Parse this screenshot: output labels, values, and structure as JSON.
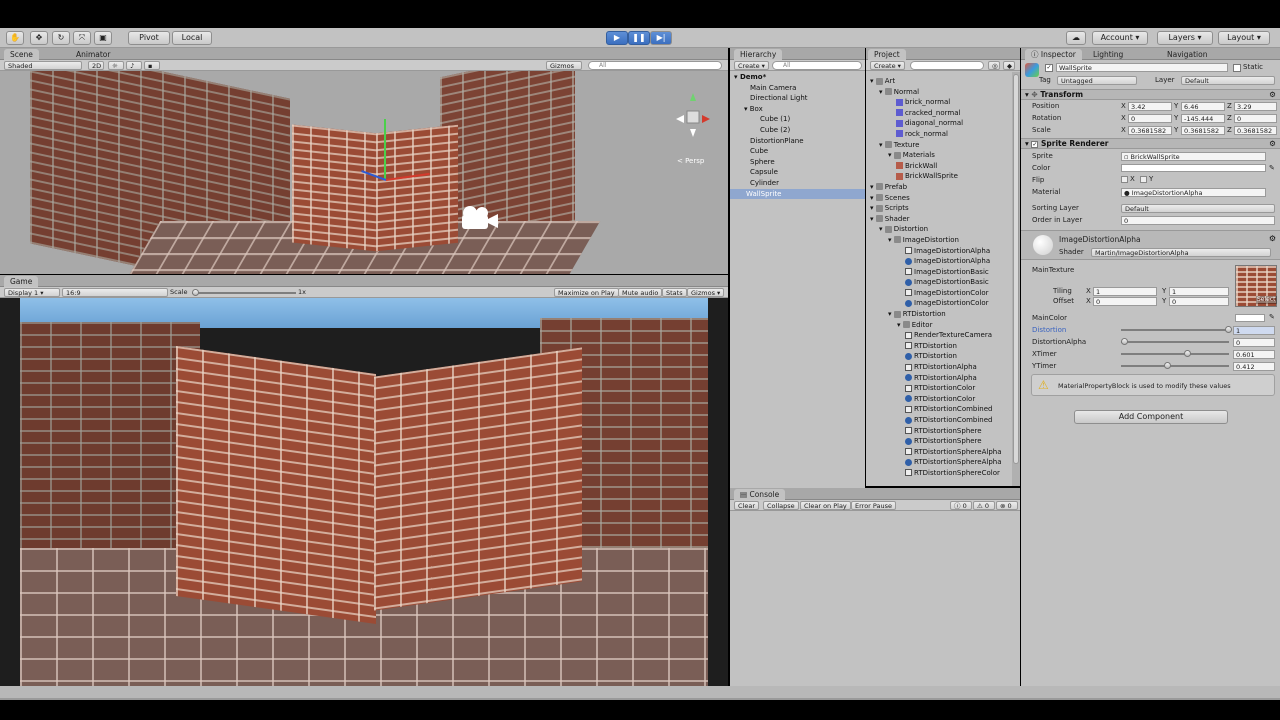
{
  "toolbar": {
    "tools": [
      "hand-icon",
      "move-icon",
      "rotate-icon",
      "scale-icon",
      "rect-icon"
    ],
    "pivot_label": "Pivot",
    "local_label": "Local",
    "play_icon": "play-icon",
    "pause_icon": "pause-icon",
    "step_icon": "step-icon",
    "cloud_icon": "cloud-icon",
    "account_label": "Account",
    "layers_label": "Layers",
    "layout_label": "Layout"
  },
  "scene": {
    "tabs": [
      "Scene",
      "Animator"
    ],
    "shading": "Shaded",
    "mode_2d": "2D",
    "gizmos_label": "Gizmos",
    "search_placeholder": "All",
    "persp_label": "< Persp"
  },
  "game": {
    "tab": "Game",
    "display": "Display 1",
    "aspect": "16:9",
    "scale_label": "Scale",
    "scale_value": "1x",
    "buttons": [
      "Maximize on Play",
      "Mute audio",
      "Stats",
      "Gizmos"
    ]
  },
  "hierarchy": {
    "tab": "Hierarchy",
    "create_label": "Create",
    "search_placeholder": "All",
    "scene_name": "Demo*",
    "items": [
      "Main Camera",
      "Directional Light",
      "Box",
      "Cube (1)",
      "Cube (2)",
      "DistortionPlane",
      "Cube",
      "Sphere",
      "Capsule",
      "Cylinder",
      "WallSprite"
    ],
    "selected": "WallSprite"
  },
  "project": {
    "tab": "Project",
    "create_label": "Create",
    "tree": [
      {
        "d": 0,
        "t": "Art",
        "k": "folder"
      },
      {
        "d": 1,
        "t": "Normal",
        "k": "folder"
      },
      {
        "d": 2,
        "t": "brick_normal",
        "k": "mat"
      },
      {
        "d": 2,
        "t": "cracked_normal",
        "k": "mat"
      },
      {
        "d": 2,
        "t": "diagonal_normal",
        "k": "mat"
      },
      {
        "d": 2,
        "t": "rock_normal",
        "k": "mat"
      },
      {
        "d": 1,
        "t": "Texture",
        "k": "folder"
      },
      {
        "d": 2,
        "t": "Materials",
        "k": "folder"
      },
      {
        "d": 2,
        "t": "BrickWall",
        "k": "tex"
      },
      {
        "d": 2,
        "t": "BrickWallSprite",
        "k": "tex"
      },
      {
        "d": 0,
        "t": "Prefab",
        "k": "folder"
      },
      {
        "d": 0,
        "t": "Scenes",
        "k": "folder"
      },
      {
        "d": 0,
        "t": "Scripts",
        "k": "folder"
      },
      {
        "d": 0,
        "t": "Shader",
        "k": "folder"
      },
      {
        "d": 1,
        "t": "Distortion",
        "k": "folder"
      },
      {
        "d": 2,
        "t": "ImageDistortion",
        "k": "folder"
      },
      {
        "d": 3,
        "t": "ImageDistortionAlpha",
        "k": "script"
      },
      {
        "d": 3,
        "t": "ImageDistortionAlpha",
        "k": "shader"
      },
      {
        "d": 3,
        "t": "ImageDistortionBasic",
        "k": "script"
      },
      {
        "d": 3,
        "t": "ImageDistortionBasic",
        "k": "shader"
      },
      {
        "d": 3,
        "t": "ImageDistortionColor",
        "k": "script"
      },
      {
        "d": 3,
        "t": "ImageDistortionColor",
        "k": "shader"
      },
      {
        "d": 2,
        "t": "RTDistortion",
        "k": "folder"
      },
      {
        "d": 3,
        "t": "Editor",
        "k": "folder"
      },
      {
        "d": 3,
        "t": "RenderTextureCamera",
        "k": "script"
      },
      {
        "d": 3,
        "t": "RTDistortion",
        "k": "script"
      },
      {
        "d": 3,
        "t": "RTDistortion",
        "k": "shader"
      },
      {
        "d": 3,
        "t": "RTDistortionAlpha",
        "k": "script"
      },
      {
        "d": 3,
        "t": "RTDistortionAlpha",
        "k": "shader"
      },
      {
        "d": 3,
        "t": "RTDistortionColor",
        "k": "script"
      },
      {
        "d": 3,
        "t": "RTDistortionColor",
        "k": "shader"
      },
      {
        "d": 3,
        "t": "RTDistortionCombined",
        "k": "script"
      },
      {
        "d": 3,
        "t": "RTDistortionCombined",
        "k": "shader"
      },
      {
        "d": 3,
        "t": "RTDistortionSphere",
        "k": "script"
      },
      {
        "d": 3,
        "t": "RTDistortionSphere",
        "k": "shader"
      },
      {
        "d": 3,
        "t": "RTDistortionSphereAlpha",
        "k": "script"
      },
      {
        "d": 3,
        "t": "RTDistortionSphereAlpha",
        "k": "shader"
      },
      {
        "d": 3,
        "t": "RTDistortionSphereColor",
        "k": "script"
      }
    ]
  },
  "console": {
    "tab": "Console",
    "buttons": [
      "Clear",
      "Collapse",
      "Clear on Play",
      "Error Pause"
    ],
    "counts": [
      "0",
      "0",
      "0"
    ]
  },
  "inspector": {
    "tabs": [
      "Inspector",
      "Lighting",
      "Navigation"
    ],
    "object_name": "WallSprite",
    "static_label": "Static",
    "tag_label": "Tag",
    "tag_value": "Untagged",
    "layer_label": "Layer",
    "layer_value": "Default",
    "transform": {
      "title": "Transform",
      "position_label": "Position",
      "position": [
        "3.42",
        "6.46",
        "3.29"
      ],
      "rotation_label": "Rotation",
      "rotation": [
        "0",
        "-145.444",
        "0"
      ],
      "scale_label": "Scale",
      "scale": [
        "0.3681582",
        "0.3681582",
        "0.3681582"
      ]
    },
    "sprite_renderer": {
      "title": "Sprite Renderer",
      "sprite_label": "Sprite",
      "sprite_value": "BrickWallSprite",
      "color_label": "Color",
      "flip_label": "Flip",
      "material_label": "Material",
      "material_value": "ImageDistortionAlpha",
      "sorting_layer_label": "Sorting Layer",
      "sorting_layer_value": "Default",
      "order_label": "Order in Layer",
      "order_value": "0"
    },
    "material": {
      "name": "ImageDistortionAlpha",
      "shader_label": "Shader",
      "shader_value": "Martin/ImageDistortionAlpha",
      "main_texture_label": "MainTexture",
      "tiling_label": "Tiling",
      "tiling": [
        "1",
        "1"
      ],
      "offset_label": "Offset",
      "offset": [
        "0",
        "0"
      ],
      "select_label": "Select",
      "main_color_label": "MainColor",
      "distortion_label": "Distortion",
      "distortion_value": "1",
      "distortion_alpha_label": "DistortionAlpha",
      "distortion_alpha_value": "0",
      "xtimer_label": "XTimer",
      "xtimer_value": "0.601",
      "ytimer_label": "YTimer",
      "ytimer_value": "0.412",
      "warning": "MaterialPropertyBlock is used to modify these values"
    },
    "add_component": "Add Component"
  }
}
